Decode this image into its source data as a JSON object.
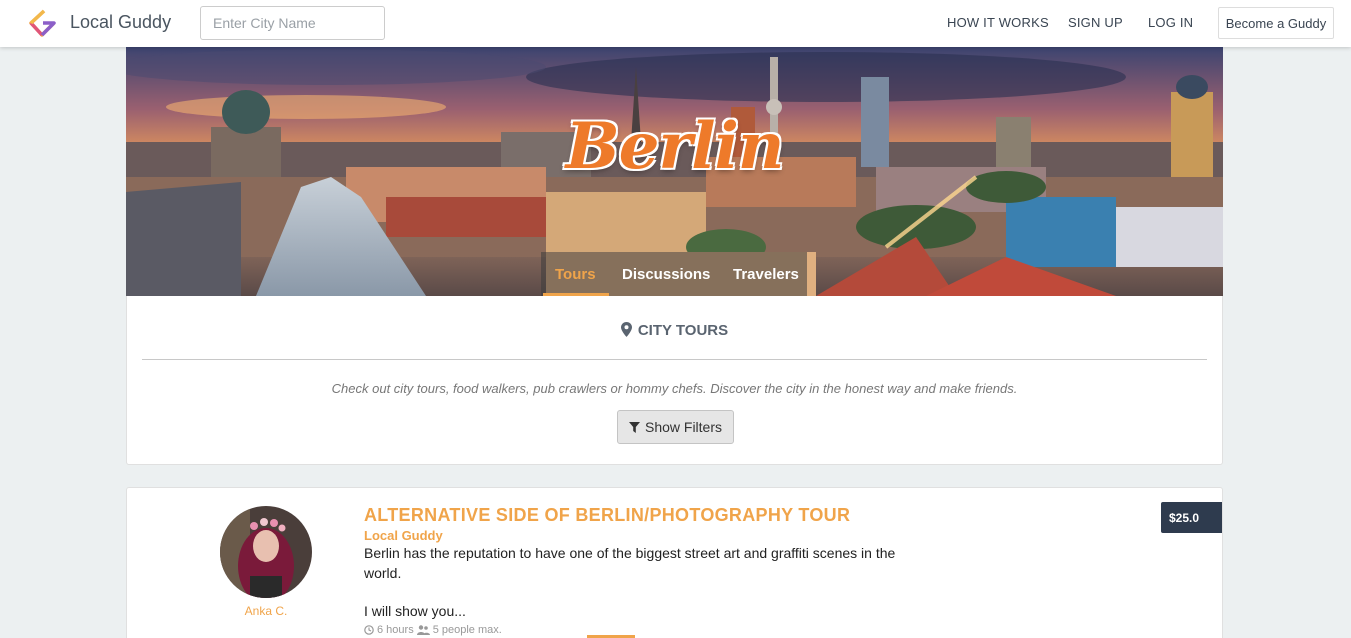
{
  "navbar": {
    "brand": "Local Guddy",
    "search_placeholder": "Enter City Name",
    "links": {
      "how_it_works": "HOW IT WORKS",
      "sign_up": "SIGN UP",
      "log_in": "LOG IN"
    },
    "become_guddy": "Become a Guddy"
  },
  "hero": {
    "city_name": "Berlin",
    "tabs": [
      "Tours",
      "Discussions",
      "Travelers"
    ],
    "active_tab": "Tours"
  },
  "tours_section": {
    "heading": "CITY TOURS",
    "heading_icon": "map-marker-icon",
    "tagline": "Check out city tours, food walkers, pub crawlers or hommy chefs. Discover the city in the honest way and make friends.",
    "filter_button": "Show Filters",
    "filter_icon": "funnel-icon"
  },
  "tour": {
    "title": "ALTERNATIVE SIDE OF BERLIN/PHOTOGRAPHY TOUR",
    "subtitle": "Local Guddy",
    "description": "Berlin has the reputation to have one of the biggest street art and graffiti scenes in the world.",
    "more": "I will show you...",
    "guide_name": "Anka C.",
    "price": "$25.0",
    "duration": "6 hours",
    "group_size": "5 people max.",
    "icons": [
      "clock-icon",
      "people-icon"
    ]
  },
  "colors": {
    "accent": "#f0a44a",
    "title_orange": "#ee7a2a",
    "price_bg": "#2e3b4e",
    "page_bg": "#ecf0f1"
  }
}
